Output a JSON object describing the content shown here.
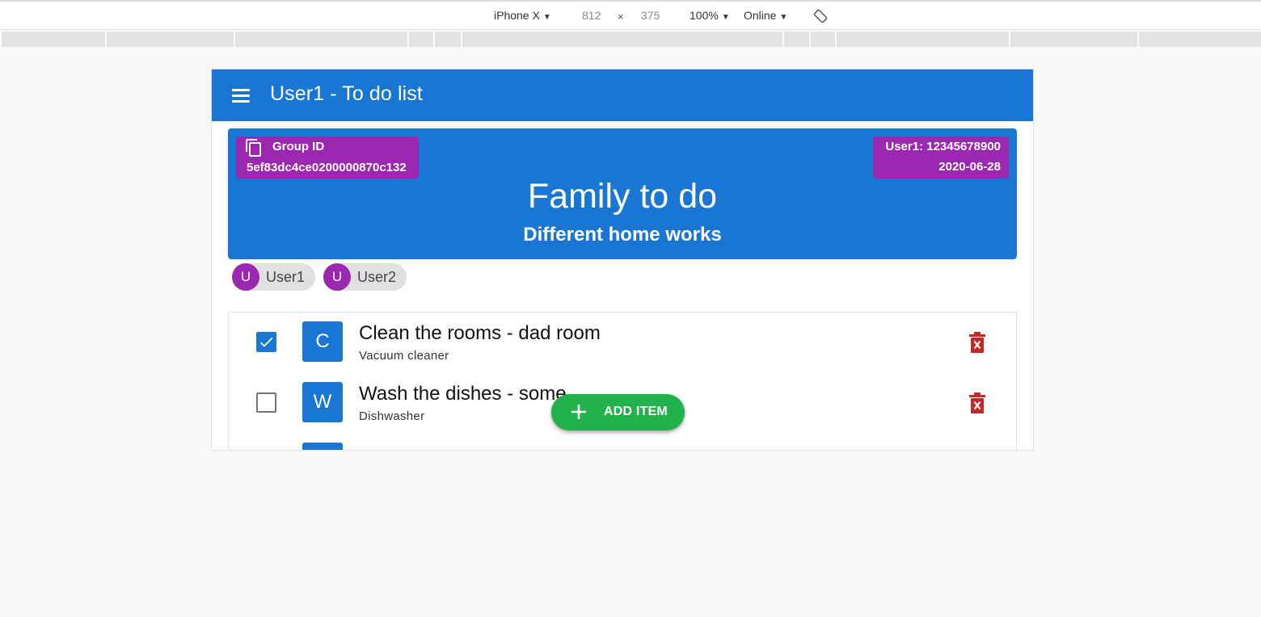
{
  "devtools": {
    "device": "iPhone X",
    "width": "812",
    "times": "×",
    "height": "375",
    "zoom": "100%",
    "network": "Online",
    "icons": {
      "caret": "triangle-down-icon",
      "rotate": "rotate-icon"
    }
  },
  "app_bar": {
    "title": "User1 - To do list",
    "menu_icon": "menu-icon",
    "color": "#1976d2"
  },
  "group": {
    "id_label": "Group ID",
    "id_value": "5ef83dc4ce0200000870c132",
    "copy_icon": "copy-icon",
    "user_line": "User1: 12345678900",
    "date": "2020-06-28",
    "title": "Family to do",
    "subtitle": "Different home works",
    "chip_color": "#9c27b0"
  },
  "members": [
    {
      "initial": "U",
      "name": "User1"
    },
    {
      "initial": "U",
      "name": "User2"
    }
  ],
  "todos": [
    {
      "checked": true,
      "initial": "C",
      "title": "Clean the rooms - dad room",
      "subtitle": "Vacuum cleaner"
    },
    {
      "checked": false,
      "initial": "W",
      "title": "Wash the dishes - some",
      "subtitle": "Dishwasher"
    },
    {
      "checked": false,
      "initial": "",
      "title": "",
      "subtitle": ""
    }
  ],
  "fab": {
    "label": "ADD ITEM",
    "icon": "plus-icon",
    "color": "#22b24c"
  },
  "delete_icon": "delete-icon",
  "delete_color": "#c62828"
}
